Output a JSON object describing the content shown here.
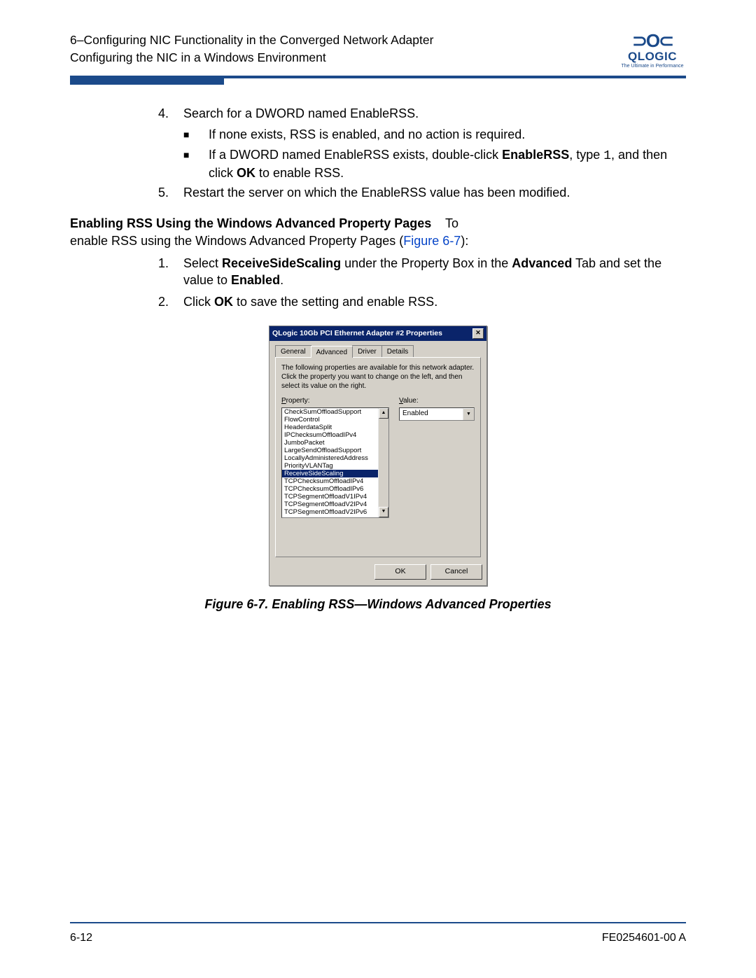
{
  "header": {
    "line1": "6–Configuring NIC Functionality in the Converged Network Adapter",
    "line2": "Configuring the NIC in a Windows Environment",
    "logo_brand": "QLOGIC",
    "logo_tagline": "The Ultimate in Performance"
  },
  "steps_a": {
    "num4": "4.",
    "text4": "Search for a DWORD named EnableRSS.",
    "bullet1": "If none exists, RSS is enabled, and no action is required.",
    "bullet2a": "If a DWORD named EnableRSS exists, double-click ",
    "bullet2_bold1": "EnableRSS",
    "bullet2b": ", type ",
    "bullet2_mono": "1",
    "bullet2c": ", and then click ",
    "bullet2_bold2": "OK",
    "bullet2d": " to enable RSS.",
    "num5": "5.",
    "text5": "Restart the server on which the EnableRSS value has been modified."
  },
  "section": {
    "heading": "Enabling RSS Using the Windows Advanced Property Pages",
    "trail": "    To",
    "intro_a": "enable RSS using the Windows Advanced Property Pages (",
    "intro_link": "Figure 6-7",
    "intro_b": "):"
  },
  "steps_b": {
    "num1": "1.",
    "t1a": "Select ",
    "t1_bold1": "ReceiveSideScaling",
    "t1b": " under the Property Box in the ",
    "t1_bold2": "Advanced",
    "t1c": " Tab and set the value to ",
    "t1_bold3": "Enabled",
    "t1d": ".",
    "num2": "2.",
    "t2a": "Click ",
    "t2_bold1": "OK",
    "t2b": " to save the setting and enable RSS."
  },
  "dialog": {
    "title": "QLogic 10Gb PCI Ethernet Adapter #2 Properties",
    "tabs": [
      "General",
      "Advanced",
      "Driver",
      "Details"
    ],
    "active_tab": 1,
    "description": "The following properties are available for this network adapter. Click the property you want to change on the left, and then select its value on the right.",
    "property_label_u": "P",
    "property_label_rest": "roperty:",
    "value_label_u": "V",
    "value_label_rest": "alue:",
    "properties": [
      "CheckSumOffloadSupport",
      "FlowControl",
      "HeaderdataSplit",
      "IPChecksumOffloadIPv4",
      "JumboPacket",
      "LargeSendOffloadSupport",
      "LocallyAdministeredAddress",
      "PriorityVLANTag",
      "ReceiveSideScaling",
      "TCPChecksumOffloadIPv4",
      "TCPChecksumOffloadIPv6",
      "TCPSegmentOffloadV1IPv4",
      "TCPSegmentOffloadV2IPv4",
      "TCPSegmentOffloadV2IPv6"
    ],
    "selected_index": 8,
    "value": "Enabled",
    "ok": "OK",
    "cancel": "Cancel"
  },
  "figure_caption": "Figure 6-7. Enabling RSS—Windows Advanced Properties",
  "footer": {
    "left": "6-12",
    "right": "FE0254601-00 A"
  }
}
